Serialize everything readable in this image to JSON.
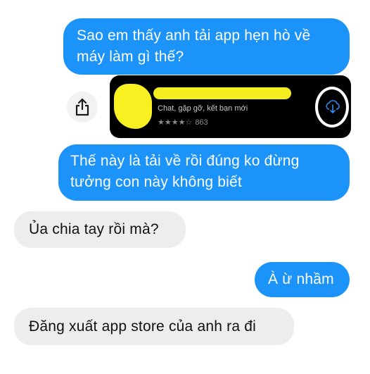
{
  "messages": [
    {
      "sender": "me",
      "lines": [
        "Sao em thấy anh tải app hẹn hò về",
        "máy làm gì thế?"
      ]
    },
    {
      "sender": "me",
      "lines": [
        "Thế này là tải về rồi đúng ko đừng",
        "tưởng con này không biết"
      ]
    },
    {
      "sender": "them",
      "lines": [
        "Ủa chia tay rồi mà?"
      ]
    },
    {
      "sender": "me",
      "lines": [
        "À ừ nhầm"
      ]
    },
    {
      "sender": "them",
      "lines": [
        "Đăng xuất app store của anh ra đi"
      ]
    }
  ],
  "app_card": {
    "subtitle": "Chat, gặp gỡ, kết bạn mới",
    "stars": "★★★★☆",
    "rating": 4,
    "rating_count": "863"
  },
  "icons": {
    "share": "share-icon",
    "download": "cloud-download-icon"
  },
  "colors": {
    "outgoing_bubble": "#1b93f8",
    "incoming_bubble": "#ededed",
    "card_background": "#000000",
    "redaction": "#f4ed1f"
  }
}
